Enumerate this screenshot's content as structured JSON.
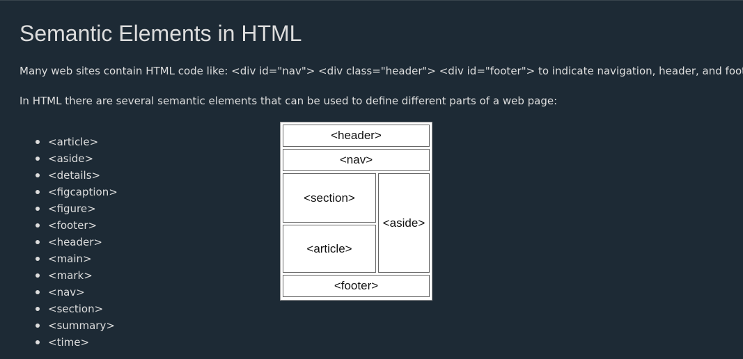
{
  "page": {
    "title": "Semantic Elements in HTML",
    "intro": "Many web sites contain HTML code like: <div id=\"nav\"> <div class=\"header\"> <div id=\"footer\"> to indicate navigation, header, and footer.",
    "semantic_intro": "In HTML there are several semantic elements that can be used to define different parts of a web page:"
  },
  "element_list": [
    "<article>",
    "<aside>",
    "<details>",
    "<figcaption>",
    "<figure>",
    "<footer>",
    "<header>",
    "<main>",
    "<mark>",
    "<nav>",
    "<section>",
    "<summary>",
    "<time>"
  ],
  "diagram": {
    "header": "<header>",
    "nav": "<nav>",
    "section": "<section>",
    "article": "<article>",
    "aside": "<aside>",
    "footer": "<footer>"
  }
}
